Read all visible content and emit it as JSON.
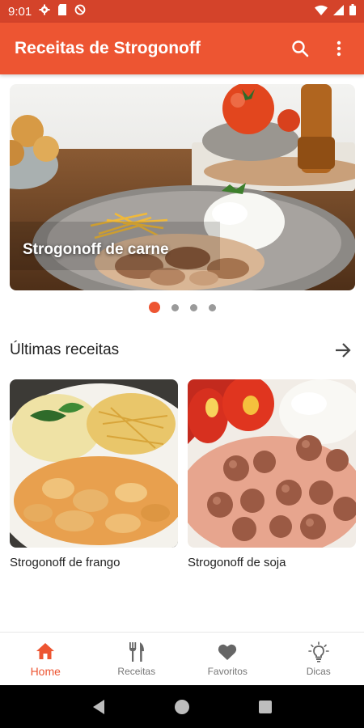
{
  "status_bar": {
    "time": "9:01",
    "icons": [
      "gear-icon",
      "sd-card-icon",
      "no-tracking-icon",
      "wifi-icon",
      "signal-icon",
      "battery-icon"
    ]
  },
  "app_bar": {
    "title": "Receitas de Strogonoff",
    "actions": [
      "search-icon",
      "more-vert-icon"
    ]
  },
  "hero": {
    "caption": "Strogonoff de carne",
    "slides_count": 4,
    "active_slide": 0
  },
  "latest": {
    "title": "Últimas receitas",
    "arrow_icon": "arrow-right-icon",
    "cards": [
      {
        "label": "Strogonoff de frango"
      },
      {
        "label": "Strogonoff de soja"
      }
    ]
  },
  "bottom_nav": {
    "items": [
      {
        "label": "Home",
        "icon": "home-icon",
        "active": true
      },
      {
        "label": "Receitas",
        "icon": "fork-knife-icon",
        "active": false
      },
      {
        "label": "Favoritos",
        "icon": "heart-icon",
        "active": false
      },
      {
        "label": "Dicas",
        "icon": "lightbulb-icon",
        "active": false
      }
    ]
  },
  "system_nav": [
    "back-icon",
    "home-circle-icon",
    "recents-icon"
  ],
  "colors": {
    "accent": "#ed5532",
    "status_bar": "#d4432a",
    "inactive": "#777777"
  }
}
